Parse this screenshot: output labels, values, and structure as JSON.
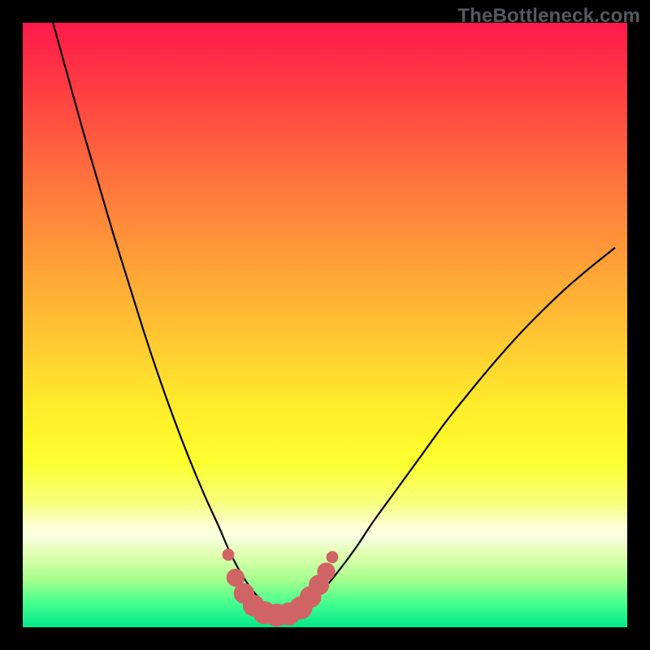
{
  "attribution": {
    "text": "TheBottleneck.com"
  },
  "colors": {
    "frame": "#000000",
    "curve": "#000000",
    "marker_fill": "#d06464",
    "marker_stroke": "none"
  },
  "chart_data": {
    "type": "line",
    "title": "",
    "xlabel": "",
    "ylabel": "",
    "xlim": [
      0,
      100
    ],
    "ylim": [
      0,
      100
    ],
    "grid": false,
    "legend": false,
    "note": "Values are read from the figure in percent of the plot area; x left→right, y bottom→top.",
    "series": [
      {
        "name": "curve",
        "x": [
          5,
          7.5,
          10,
          12.5,
          15,
          17.5,
          20,
          22.5,
          25,
          27.5,
          30,
          32.5,
          34,
          35.5,
          37,
          38.5,
          40,
          42,
          44,
          46,
          49,
          52,
          55,
          58,
          62,
          66,
          70,
          74,
          78,
          82,
          86,
          90,
          94,
          98
        ],
        "y": [
          100,
          91,
          82,
          73.5,
          65,
          57,
          49,
          41.5,
          34.5,
          28,
          22,
          16.5,
          13,
          10,
          7.5,
          5.5,
          4,
          3,
          2.7,
          3.3,
          5.5,
          9,
          13,
          17.5,
          23,
          28.5,
          34,
          39,
          43.8,
          48.3,
          52.4,
          56.2,
          59.6,
          62.8
        ]
      }
    ],
    "markers": {
      "name": "bottom-pink-markers",
      "points": [
        {
          "x": 34.0,
          "y": 12.0,
          "r": 1.0
        },
        {
          "x": 35.2,
          "y": 8.2,
          "r": 1.5
        },
        {
          "x": 36.6,
          "y": 5.6,
          "r": 1.7
        },
        {
          "x": 38.2,
          "y": 3.6,
          "r": 1.8
        },
        {
          "x": 40.0,
          "y": 2.4,
          "r": 1.9
        },
        {
          "x": 42.0,
          "y": 2.0,
          "r": 1.9
        },
        {
          "x": 44.0,
          "y": 2.2,
          "r": 1.9
        },
        {
          "x": 46.0,
          "y": 3.2,
          "r": 1.9
        },
        {
          "x": 47.6,
          "y": 5.0,
          "r": 1.8
        },
        {
          "x": 49.0,
          "y": 7.0,
          "r": 1.7
        },
        {
          "x": 50.2,
          "y": 9.2,
          "r": 1.5
        },
        {
          "x": 51.2,
          "y": 11.6,
          "r": 1.0
        }
      ]
    }
  }
}
